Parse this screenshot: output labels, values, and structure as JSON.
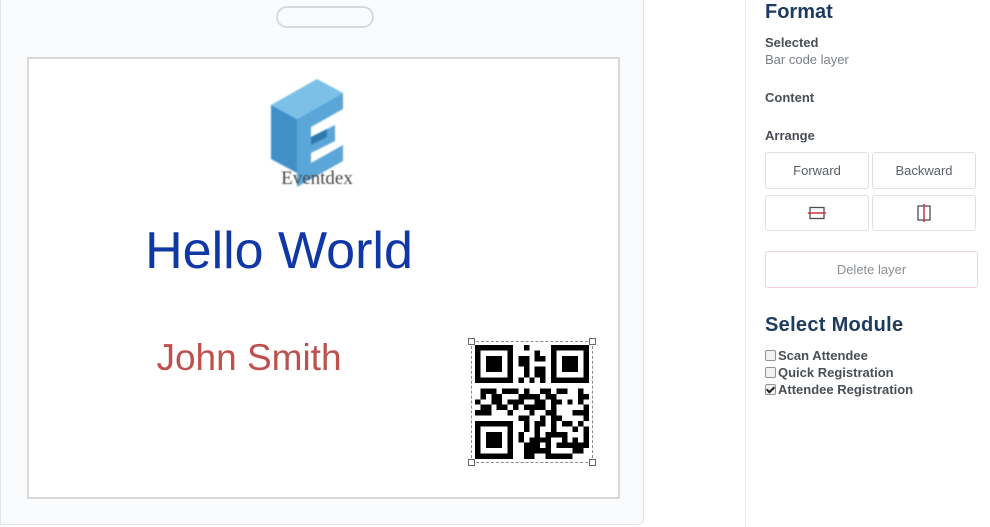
{
  "badge": {
    "logo_text": "Eventdex",
    "headline": "Hello World",
    "attendee_name": "John Smith"
  },
  "format_panel": {
    "title": "Format",
    "selected_label": "Selected",
    "selected_value": "Bar code layer",
    "content_label": "Content",
    "arrange_label": "Arrange",
    "forward_label": "Forward",
    "backward_label": "Backward",
    "align_horizontal_icon": "align-horizontal-center-icon",
    "align_vertical_icon": "align-vertical-center-icon",
    "delete_label": "Delete layer"
  },
  "module_panel": {
    "title": "Select Module",
    "options": [
      {
        "label": "Scan Attendee",
        "checked": false
      },
      {
        "label": "Quick Registration",
        "checked": false
      },
      {
        "label": "Attendee Registration",
        "checked": true
      }
    ]
  },
  "colors": {
    "headline": "#0f37a6",
    "attendee_name": "#c0504d",
    "panel_title": "#1d3a5f",
    "logo_blue": "#5aa6d8"
  }
}
